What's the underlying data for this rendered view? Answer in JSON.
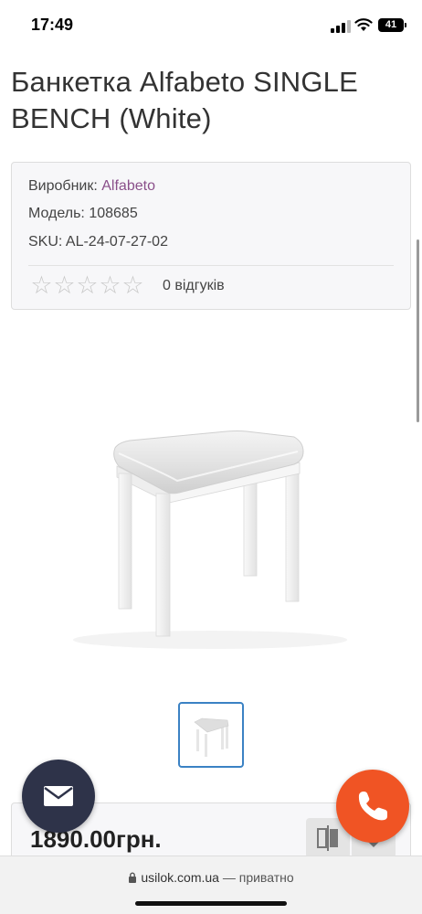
{
  "status_bar": {
    "time": "17:49",
    "battery": "41"
  },
  "product": {
    "title": "Банкетка Alfabeto SINGLE BENCH (White)",
    "manufacturer_label": "Виробник:",
    "manufacturer": "Alfabeto",
    "model_label": "Модель:",
    "model": "108685",
    "sku_label": "SKU:",
    "sku": "AL-24-07-27-02",
    "rating": 0,
    "rating_max": 5,
    "reviews": "0 відгуків",
    "price": "1890.00грн."
  },
  "icons": {
    "mail": "envelope-icon",
    "call": "phone-icon",
    "compare": "compare-icon",
    "wishlist": "heart-icon",
    "lock": "lock-icon"
  },
  "browser": {
    "domain": "usilok.com.ua",
    "privacy": "— приватно"
  },
  "colors": {
    "link": "#8a4f8a",
    "mail_fab": "#2e3349",
    "call_fab": "#f05424",
    "thumb_border": "#3b82c4"
  }
}
